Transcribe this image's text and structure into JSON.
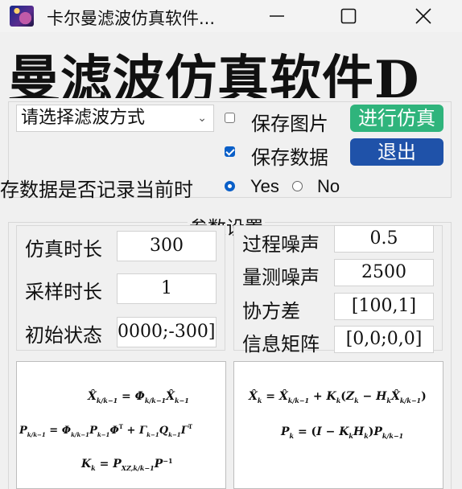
{
  "window": {
    "title": "卡尔曼滤波仿真软件..."
  },
  "banner": {
    "text": "曼滤波仿真软件D"
  },
  "controls": {
    "method_select": {
      "value": "请选择滤波方式"
    },
    "save_image": {
      "label": "保存图片",
      "checked": false
    },
    "save_data": {
      "label": "保存数据",
      "checked": true
    },
    "run_button": "进行仿真",
    "exit_button": "退出",
    "record_question": "存数据是否记录当前时",
    "radio_yes": {
      "label": "Yes",
      "selected": true
    },
    "radio_no": {
      "label": "No",
      "selected": false
    }
  },
  "params": {
    "group_title": "参数设置",
    "sim_duration": {
      "label": "仿真时长",
      "value": "300"
    },
    "sample_duration": {
      "label": "采样时长",
      "value": "1"
    },
    "initial_state": {
      "label": "初始状态",
      "value": "0000;-300]"
    },
    "process_noise": {
      "label": "过程噪声",
      "value": "0.5"
    },
    "measure_noise": {
      "label": "量测噪声",
      "value": "2500"
    },
    "covariance": {
      "label": "协方差",
      "value": "[100,1]"
    },
    "info_matrix": {
      "label": "信息矩阵",
      "value": "[0,0;0,0]"
    }
  },
  "colors": {
    "run_button": "#2fb47c",
    "exit_button": "#1f52a9",
    "accent": "#0a5fc8"
  }
}
